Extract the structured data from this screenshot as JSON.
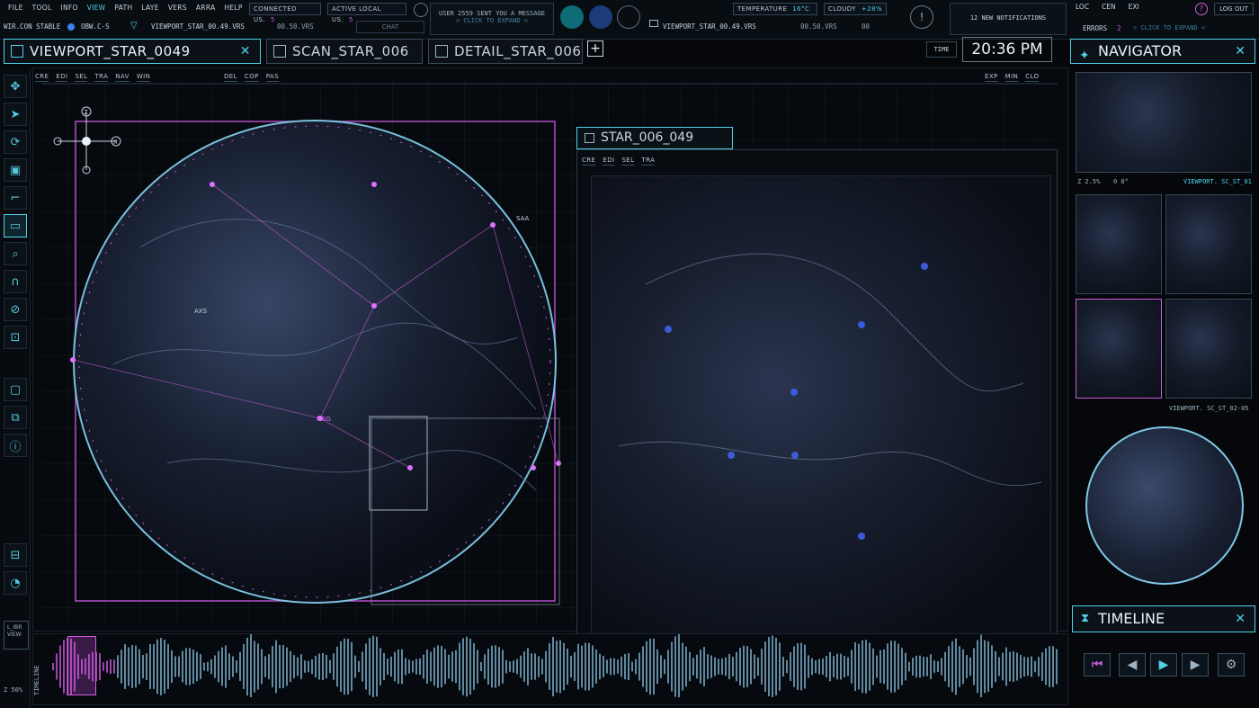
{
  "menu": [
    "FILE",
    "TOOL",
    "INFO",
    "VIEW",
    "PATH",
    "LAYE",
    "VERS",
    "ARRA",
    "HELP"
  ],
  "menu_active": "VIEW",
  "status": {
    "connected_label": "CONNECTED US.",
    "connected_count": "5",
    "active_label": "ACTIVE LOCAL US.",
    "active_count": "5",
    "wircon": "WIR.CON STABLE",
    "obw": "OBW.C-S",
    "viewport_file": "VIEWPORT_STAR_00.49.VRS",
    "version_file": "00.50.VRS",
    "chat": "CHAT",
    "message_line1": "USER 2559 SENT YOU A MESSAGE",
    "message_line2": "> CLICK TO EXPAND <",
    "file2": "VIEWPORT_STAR_00.49.VRS",
    "file2_ver": "00.50.VRS",
    "file2_num": "00",
    "temperature_label": "TEMPERATURE",
    "temperature_value": "16°C",
    "weather_label": "CLOUDY",
    "weather_value": "+28%",
    "notifications": "12 NEW NOTIFICATIONS",
    "right_menu": [
      "LOC",
      "CEN",
      "EXI"
    ],
    "logout": "LOG OUT",
    "errors_label": "ERRORS",
    "errors_count": "2",
    "errors_link": "> CLICK TO EXPAND <"
  },
  "tabs": [
    "VIEWPORT_STAR_0049",
    "SCAN_STAR_006",
    "DETAIL_STAR_006"
  ],
  "time_label": "TIME",
  "time_value": "20:36 PM",
  "navigator_title": "NAVIGATOR",
  "main_subtoolbar": [
    "CRE",
    "EDI",
    "SEL",
    "TRA",
    "NAV",
    "WIN"
  ],
  "main_subtoolbar2": [
    "DEL",
    "COP",
    "PAS"
  ],
  "main_subtoolbar3": [
    "EXP",
    "MIN",
    "CLO"
  ],
  "axis_labels": {
    "z": "Z",
    "x": "X"
  },
  "planet_labels": {
    "saa": "SAA",
    "axs": "AXS",
    "msg": "MSG"
  },
  "detail_title": "STAR_006_049",
  "detail_subtoolbar": [
    "CRE",
    "EDI",
    "SEL",
    "TRA"
  ],
  "nav_zoom": "Z 2.5%",
  "nav_angle": "0 0°",
  "nav_view1": "VIEWPORT. SC_ST_01",
  "nav_view2": "VIEWPORT. SC_ST_02-05",
  "timeline_title": "TIMELINE",
  "timeline_side": "TIMELINE",
  "timeline_zoom": "Z 50%",
  "logo": "L_IBR VIEW",
  "colors": {
    "accent": "#4fd1e8",
    "magenta": "#d05ce0",
    "border": "#2c3a47"
  },
  "icons": [
    "move-icon",
    "pointer-icon",
    "rotate-icon",
    "scale-icon",
    "path-icon",
    "viewport-icon",
    "zoom-icon",
    "magnet-icon",
    "shape-icon",
    "lock-icon",
    "frame-icon",
    "layers-icon",
    "info-icon",
    "ticket-icon",
    "gauge-icon"
  ]
}
